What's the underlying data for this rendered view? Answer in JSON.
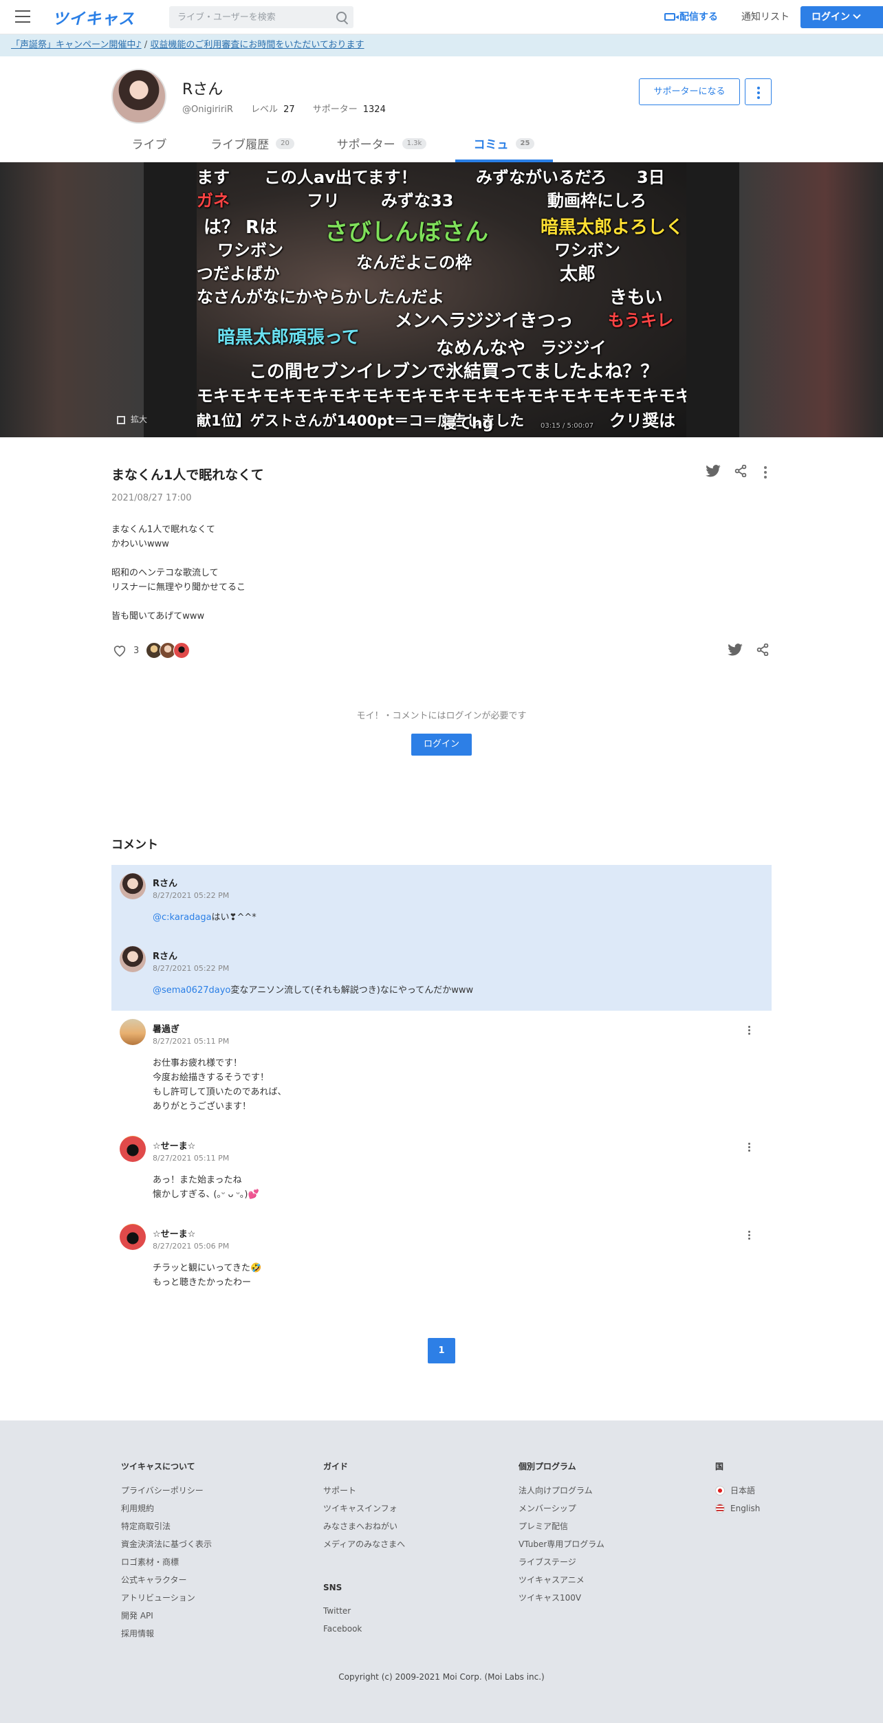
{
  "header": {
    "logo": "ツイキャス",
    "search_placeholder": "ライブ・ユーザーを検索",
    "broadcast_label": "配信する",
    "notify_label": "通知リスト",
    "login_label": "ログイン"
  },
  "banner": {
    "link1": "「声誕祭」キャンペーン開催中♪",
    "separator": " / ",
    "link2": "収益機能のご利用審査にお時間をいただいております"
  },
  "profile": {
    "name": "Rさん",
    "handle": "@OnigiririR",
    "level_label": "レベル",
    "level": "27",
    "supporter_label": "サポーター",
    "supporters": "1324",
    "support_button": "サポーターになる"
  },
  "tabs": [
    {
      "label": "ライブ",
      "count": ""
    },
    {
      "label": "ライブ履歴",
      "count": "20"
    },
    {
      "label": "サポーター",
      "count": "1.3k"
    },
    {
      "label": "コミュ",
      "count": "25"
    }
  ],
  "video": {
    "expand_label": "拡大",
    "comments": [
      "ます",
      "この人av出てます！",
      "みずながいるだろ",
      "3日",
      "ガネ",
      "フリ",
      "みずな33",
      "動画枠にしろ",
      "は？ Rは",
      "さびしんぼさん",
      "暗黒太郎よろしく",
      "ワシボン",
      "なんだよこの枠",
      "ワシボン",
      "つだよばか",
      "太郎",
      "なさんがなにかやらかしたんだよ",
      "きもい",
      "メンヘラジジイきつっ",
      "もうキレ",
      "暗黒太郎頑張って",
      "なめんなや",
      "ラジジイ",
      "この間セブンイレブンで氷結買ってましたよね？？",
      "モキモキモキモキモキモキモキモキモキモキモキモキモキモキモキ",
      "献1位】ゲストさんが1400pt＝コ＝広告しました",
      "寝てhg",
      "クリ奨は",
      "03:15 / 5:00:07"
    ]
  },
  "post": {
    "title": "まなくん1人で眠れなくて",
    "date": "2021/08/27 17:00",
    "body": [
      "まなくん1人で眠れなくて",
      "かわいいwww",
      "",
      "昭和のヘンテコな歌流して",
      "リスナーに無理やり聞かせてるこ",
      "",
      "皆も聞いてあげてwww"
    ],
    "like_count": "3"
  },
  "login_prompt": {
    "message": "モイ！・コメントにはログインが必要です",
    "button": "ログイン"
  },
  "comments_heading": "コメント",
  "comments": [
    {
      "name": "Rさん",
      "time": "8/27/2021 05:22 PM",
      "mention": "@c:karadaga",
      "text": [
        "はい❣^^*"
      ]
    },
    {
      "name": "Rさん",
      "time": "8/27/2021 05:22 PM",
      "mention": "@sema0627dayo",
      "text": [
        "変なアニソン流して(それも解説つき)なにやってんだかwww"
      ]
    },
    {
      "name": "暑過ぎ",
      "time": "8/27/2021 05:11 PM",
      "mention": "",
      "text": [
        "お仕事お疲れ様です！",
        "今度お絵描きするそうです！",
        "もし許可して頂いたのであれば、",
        "ありがとうございます！"
      ]
    },
    {
      "name": "☆せーま☆",
      "time": "8/27/2021 05:11 PM",
      "mention": "",
      "text": [
        "あっ！また始まったね",
        "懐かしすぎる､ (｡ᵕ ᴗ ᵕ｡)💕"
      ]
    },
    {
      "name": "☆せーま☆",
      "time": "8/27/2021 05:06 PM",
      "mention": "",
      "text": [
        "チラッと観にいってきた🤣",
        "もっと聴きたかったわー"
      ]
    }
  ],
  "pagination": {
    "current": "1"
  },
  "footer": {
    "col1": {
      "title": "ツイキャスについて",
      "links": [
        "プライバシーポリシー",
        "利用規約",
        "特定商取引法",
        "資金決済法に基づく表示",
        "ロゴ素材・商標",
        "公式キャラクター",
        "アトリビューション",
        "開発 API",
        "採用情報"
      ]
    },
    "col2": {
      "title": "ガイド",
      "links": [
        "サポート",
        "ツイキャスインフォ",
        "みなさまへおねがい",
        "メディアのみなさまへ"
      ]
    },
    "col2b": {
      "title": "SNS",
      "links": [
        "Twitter",
        "Facebook"
      ]
    },
    "col3": {
      "title": "個別プログラム",
      "links": [
        "法人向けプログラム",
        "メンバーシップ",
        "プレミア配信",
        "VTuber専用プログラム",
        "ライブステージ",
        "ツイキャスアニメ",
        "ツイキャス100V"
      ]
    },
    "col4": {
      "title": "国",
      "links": [
        "日本語",
        "English"
      ]
    },
    "copyright": "Copyright (c) 2009-2021 Moi Corp. (Moi Labs inc.)"
  },
  "colors": {
    "accent": "#2d7fe6",
    "banner_bg": "#dcecf4",
    "highlight_bg": "#dde9f8",
    "footer_bg": "#e2e5ea"
  }
}
